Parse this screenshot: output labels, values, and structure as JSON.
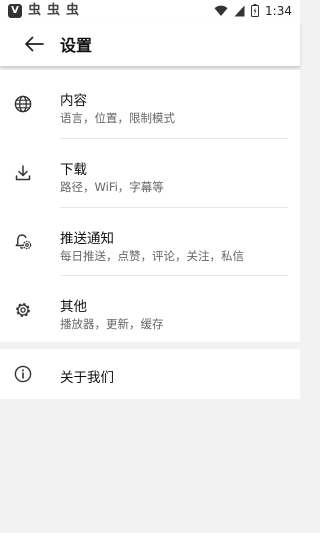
{
  "status_bar": {
    "app_badge": "V",
    "notification_glyphs": [
      "虫",
      "虫",
      "虫"
    ],
    "time": "1:34",
    "icons": [
      "wifi-icon",
      "signal-icon",
      "battery-icon"
    ]
  },
  "header": {
    "title": "设置"
  },
  "settings": {
    "items": [
      {
        "icon": "globe-icon",
        "title": "内容",
        "subtitle": "语言，位置，限制模式"
      },
      {
        "icon": "download-icon",
        "title": "下载",
        "subtitle": "路径，WiFi，字幕等"
      },
      {
        "icon": "bell-settings-icon",
        "title": "推送通知",
        "subtitle": "每日推送，点赞，评论，关注，私信"
      },
      {
        "icon": "gear-icon",
        "title": "其他",
        "subtitle": "播放器，更新，缓存"
      }
    ]
  },
  "about": {
    "icon": "info-icon",
    "title": "关于我们"
  }
}
